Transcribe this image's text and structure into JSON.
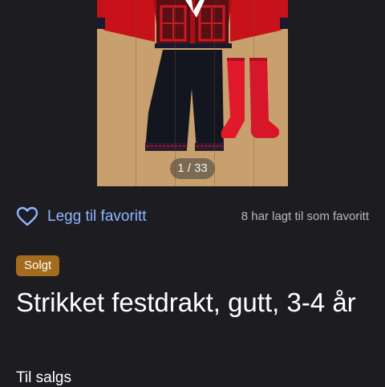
{
  "gallery": {
    "counter": "1 / 33",
    "image_alt": "Strikket festdrakt, gutt, 3-4 år"
  },
  "favorite": {
    "label": "Legg til favoritt",
    "icon": "heart-outline-icon",
    "count_text": "8 har lagt til som favoritt"
  },
  "status_badge": "Solgt",
  "listing": {
    "title": "Strikket festdrakt, gutt, 3-4 år",
    "section_heading": "Til salgs"
  },
  "colors": {
    "background": "#1c1c21",
    "link": "#8fb6ff",
    "badge": "#a36c1c",
    "muted_text": "#b9b9bf"
  }
}
